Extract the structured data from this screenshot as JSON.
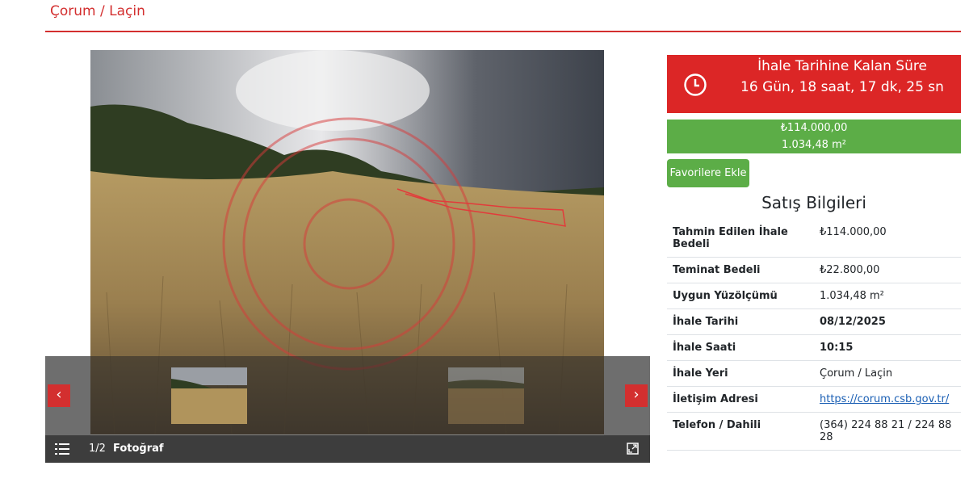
{
  "page": {
    "title": "Çorum / Laçin"
  },
  "gallery": {
    "counter": "1/2",
    "caption": "Fotoğraf",
    "prev_label": "‹",
    "next_label": "›"
  },
  "countdown": {
    "label": "İhale Tarihine Kalan Süre",
    "value": "16 Gün, 18 saat, 17 dk, 25 sn"
  },
  "price": {
    "amount": "₺114.000,00",
    "area": "1.034,48 m²"
  },
  "favorite_button": "Favorilere Ekle",
  "sales_info": {
    "title": "Satış Bilgileri",
    "rows": [
      {
        "label": "Tahmin Edilen İhale Bedeli",
        "value": "₺114.000,00"
      },
      {
        "label": "Teminat Bedeli",
        "value": "₺22.800,00"
      },
      {
        "label": "Uygun Yüzölçümü",
        "value": "1.034,48 m²"
      },
      {
        "label": "İhale Tarihi",
        "value": "08/12/2025"
      },
      {
        "label": "İhale Saati",
        "value": "10:15"
      },
      {
        "label": "İhale Yeri",
        "value": "Çorum / Laçin"
      },
      {
        "label": "İletişim Adresi",
        "value": "https://corum.csb.gov.tr/"
      },
      {
        "label": "Telefon / Dahili",
        "value": "(364) 224 88 21 / 224 88 28"
      }
    ]
  },
  "colors": {
    "accent_red": "#dc2626",
    "accent_green": "#5cad47"
  },
  "icons": [
    "clock-icon",
    "list-icon",
    "expand-icon",
    "chevron-left-icon",
    "chevron-right-icon"
  ]
}
